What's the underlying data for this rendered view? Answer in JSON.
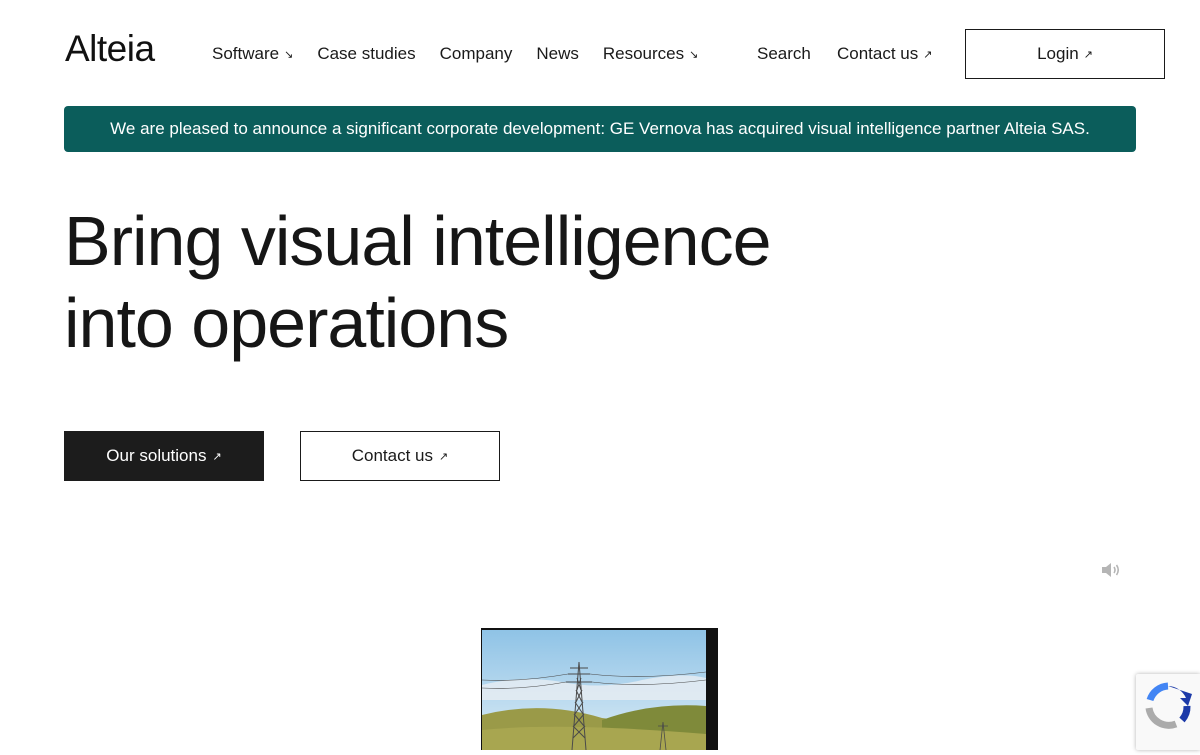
{
  "header": {
    "logo": "Alteia",
    "nav": [
      {
        "label": "Software",
        "arrow": "↘"
      },
      {
        "label": "Case studies",
        "arrow": ""
      },
      {
        "label": "Company",
        "arrow": ""
      },
      {
        "label": "News",
        "arrow": ""
      },
      {
        "label": "Resources",
        "arrow": "↘"
      }
    ],
    "search_label": "Search",
    "contact_label": "Contact us",
    "contact_arrow": "↗",
    "login_label": "Login",
    "login_arrow": "↗"
  },
  "banner": {
    "text": "We are pleased to announce a significant corporate development: GE Vernova has acquired visual intelligence partner Alteia SAS.",
    "bg_color": "#0b5d5b"
  },
  "hero": {
    "title_line1": "Bring visual intelligence",
    "title_line2": "into operations",
    "primary_label": "Our solutions",
    "primary_arrow": "↗",
    "secondary_label": "Contact us",
    "secondary_arrow": "↗"
  },
  "icons": {
    "sound": "speaker-icon",
    "recaptcha": "recaptcha-icon"
  }
}
